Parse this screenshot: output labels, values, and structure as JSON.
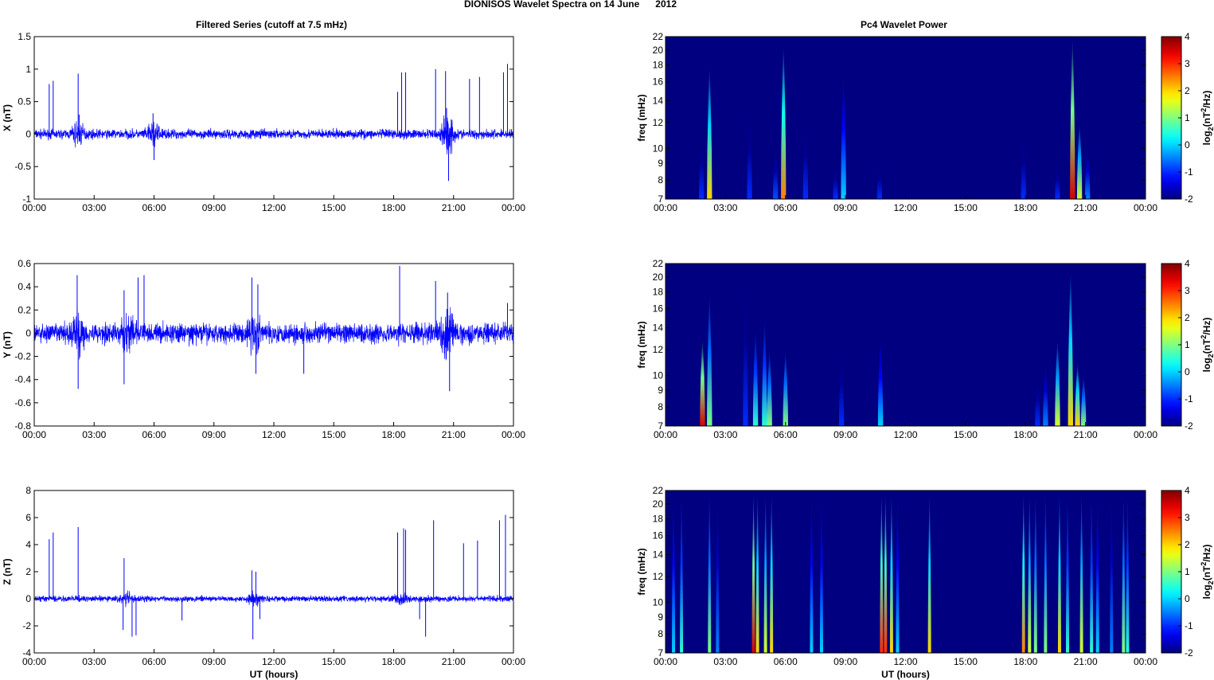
{
  "chart_data": {
    "suptitle": "DIONISOS Wavelet Spectra on 14 June      2012",
    "left_title": "Filtered Series (cutoff at 7.5 mHz)",
    "right_title": "Pc4 Wavelet Power",
    "xlabel": "UT (hours)",
    "xticks": [
      "00:00",
      "03:00",
      "06:00",
      "09:00",
      "12:00",
      "15:00",
      "18:00",
      "21:00",
      "00:00"
    ],
    "xlim": [
      0,
      24
    ],
    "colorbar": {
      "label_main": "log",
      "label_sub": "2",
      "label_rest": "(nT",
      "label_sup": "2",
      "label_end": "/Hz)",
      "ticks": [
        "4",
        "3",
        "2",
        "1",
        "0",
        "-1",
        "-2"
      ],
      "range": [
        -2,
        4
      ]
    },
    "series": [
      {
        "type": "line",
        "name": "X",
        "ylabel": "X (nT)",
        "ylim": [
          -1,
          1.5
        ],
        "yticks": [
          "1.5",
          "1",
          "0.5",
          "0",
          "-0.5",
          "-1"
        ],
        "tickvals": [
          1.5,
          1,
          0.5,
          0,
          -0.5,
          -1
        ],
        "noise": 0.05,
        "color": "#0000ff",
        "spikes": [
          [
            0.75,
            0.77
          ],
          [
            0.95,
            0.82
          ],
          [
            2.2,
            0.93
          ],
          [
            2.25,
            0.3
          ],
          [
            5.95,
            0.32
          ],
          [
            6.0,
            -0.4
          ],
          [
            18.2,
            0.65
          ],
          [
            18.4,
            0.95
          ],
          [
            18.6,
            0.95
          ],
          [
            20.1,
            1.0
          ],
          [
            20.6,
            0.97
          ],
          [
            20.75,
            -0.72
          ],
          [
            20.65,
            0.4
          ],
          [
            21.8,
            0.85
          ],
          [
            22.3,
            0.88
          ],
          [
            23.5,
            0.95
          ],
          [
            23.7,
            1.08
          ]
        ],
        "bursts": [
          [
            2.2,
            0.1
          ],
          [
            6.0,
            0.1
          ],
          [
            20.7,
            0.2
          ]
        ]
      },
      {
        "type": "line",
        "name": "Y",
        "ylabel": "Y (nT)",
        "ylim": [
          -0.8,
          0.6
        ],
        "yticks": [
          "0.6",
          "0.4",
          "0.2",
          "0",
          "-0.2",
          "-0.4",
          "-0.6",
          "-0.8"
        ],
        "tickvals": [
          0.6,
          0.4,
          0.2,
          0,
          -0.2,
          -0.4,
          -0.6,
          -0.8
        ],
        "noise": 0.06,
        "color": "#0000ff",
        "spikes": [
          [
            2.15,
            0.5
          ],
          [
            2.2,
            -0.48
          ],
          [
            4.5,
            0.37
          ],
          [
            4.5,
            -0.44
          ],
          [
            5.2,
            0.48
          ],
          [
            5.5,
            0.5
          ],
          [
            10.9,
            0.48
          ],
          [
            11.2,
            0.42
          ],
          [
            11.1,
            -0.35
          ],
          [
            13.5,
            -0.35
          ],
          [
            18.3,
            0.58
          ],
          [
            20.1,
            0.45
          ],
          [
            20.7,
            0.35
          ],
          [
            20.8,
            -0.5
          ],
          [
            23.7,
            0.26
          ]
        ],
        "bursts": [
          [
            2.2,
            0.1
          ],
          [
            4.7,
            0.08
          ],
          [
            11.0,
            0.08
          ],
          [
            20.7,
            0.12
          ]
        ]
      },
      {
        "type": "line",
        "name": "Z",
        "ylabel": "Z (nT)",
        "ylim": [
          -4,
          8
        ],
        "yticks": [
          "8",
          "6",
          "4",
          "2",
          "0",
          "-2",
          "-4"
        ],
        "tickvals": [
          8,
          6,
          4,
          2,
          0,
          -2,
          -4
        ],
        "noise": 0.15,
        "color": "#0000ff",
        "spikes": [
          [
            0.75,
            4.4
          ],
          [
            0.95,
            4.9
          ],
          [
            2.2,
            5.3
          ],
          [
            4.5,
            3.0
          ],
          [
            4.45,
            -2.3
          ],
          [
            4.9,
            -2.8
          ],
          [
            5.1,
            -2.7
          ],
          [
            7.4,
            -1.6
          ],
          [
            10.9,
            2.1
          ],
          [
            11.1,
            2.0
          ],
          [
            10.95,
            -3.0
          ],
          [
            11.3,
            -1.5
          ],
          [
            18.2,
            4.9
          ],
          [
            18.5,
            5.2
          ],
          [
            18.6,
            5.1
          ],
          [
            19.3,
            -1.5
          ],
          [
            19.6,
            -2.8
          ],
          [
            20.0,
            5.8
          ],
          [
            21.5,
            4.1
          ],
          [
            22.2,
            4.3
          ],
          [
            23.3,
            5.8
          ],
          [
            23.6,
            6.2
          ]
        ],
        "bursts": [
          [
            4.6,
            0.25
          ],
          [
            11.0,
            0.3
          ],
          [
            18.4,
            0.2
          ]
        ]
      }
    ],
    "wavelets": [
      {
        "type": "heatmap",
        "name": "X",
        "ylabel": "freq (mHz)",
        "yticks": [
          22,
          20,
          18,
          16,
          14,
          12,
          10,
          9,
          8,
          7
        ],
        "ylim": [
          7,
          22
        ],
        "events": [
          [
            1.8,
            11,
            -1
          ],
          [
            2.2,
            18,
            2
          ],
          [
            4.2,
            13,
            -1
          ],
          [
            5.5,
            10,
            -0.8
          ],
          [
            5.9,
            21,
            2.5
          ],
          [
            7.0,
            12,
            -1
          ],
          [
            8.5,
            9,
            -1
          ],
          [
            8.9,
            17,
            0
          ],
          [
            10.7,
            9,
            -1
          ],
          [
            17.9,
            11,
            -1
          ],
          [
            19.6,
            9,
            -1
          ],
          [
            20.35,
            22,
            3.5
          ],
          [
            20.7,
            12,
            1.5
          ],
          [
            21.1,
            10,
            -0.5
          ]
        ]
      },
      {
        "type": "heatmap",
        "name": "Y",
        "ylabel": "freq (mHz)",
        "yticks": [
          22,
          20,
          18,
          16,
          14,
          12,
          10,
          9,
          8,
          7
        ],
        "ylim": [
          7,
          22
        ],
        "events": [
          [
            1.85,
            13,
            3.5
          ],
          [
            2.2,
            18,
            1
          ],
          [
            4.0,
            20,
            -1
          ],
          [
            4.5,
            14,
            0.5
          ],
          [
            4.95,
            15,
            0.5
          ],
          [
            5.2,
            12,
            1
          ],
          [
            6.0,
            12,
            1
          ],
          [
            8.8,
            12,
            -1
          ],
          [
            10.75,
            13,
            0
          ],
          [
            18.6,
            10,
            -1
          ],
          [
            19.0,
            11,
            -0.5
          ],
          [
            19.6,
            13,
            1.5
          ],
          [
            20.25,
            21,
            2
          ],
          [
            20.6,
            11,
            2
          ],
          [
            20.9,
            10,
            1
          ]
        ]
      },
      {
        "type": "heatmap",
        "name": "Z",
        "ylabel": "freq (mHz)",
        "yticks": [
          22,
          20,
          18,
          16,
          14,
          12,
          10,
          9,
          8,
          7
        ],
        "ylim": [
          7,
          22
        ],
        "events": [
          [
            0.4,
            22,
            0
          ],
          [
            0.8,
            22,
            0.5
          ],
          [
            2.2,
            22,
            1
          ],
          [
            2.6,
            22,
            -0.5
          ],
          [
            4.4,
            22,
            3.5
          ],
          [
            4.6,
            22,
            2
          ],
          [
            5.0,
            22,
            1.5
          ],
          [
            5.3,
            22,
            2
          ],
          [
            7.3,
            22,
            0
          ],
          [
            7.8,
            22,
            0
          ],
          [
            10.8,
            22,
            3
          ],
          [
            11.0,
            22,
            3
          ],
          [
            11.3,
            22,
            2
          ],
          [
            11.6,
            22,
            0
          ],
          [
            13.2,
            22,
            2
          ],
          [
            17.9,
            22,
            2.5
          ],
          [
            18.2,
            22,
            1.5
          ],
          [
            18.5,
            22,
            1
          ],
          [
            19.0,
            22,
            1
          ],
          [
            19.7,
            22,
            2
          ],
          [
            20.1,
            22,
            0.5
          ],
          [
            20.8,
            22,
            1.5
          ],
          [
            21.3,
            22,
            0.5
          ],
          [
            21.6,
            22,
            0
          ],
          [
            22.3,
            22,
            -0.5
          ],
          [
            22.9,
            22,
            1
          ],
          [
            23.1,
            22,
            0.5
          ]
        ]
      }
    ]
  }
}
